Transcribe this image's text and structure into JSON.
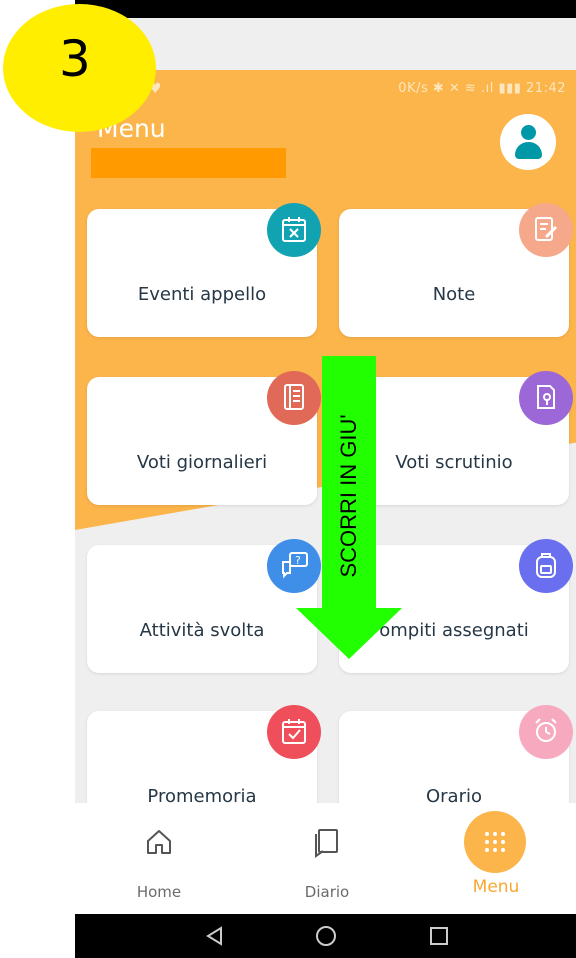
{
  "step_number": "3",
  "statusbar": {
    "left_glyph": "♥",
    "right_text": "0K/s ✱ ✕ ≋ .ıl ▮▮▮ 21:42"
  },
  "header": {
    "title": "Menu"
  },
  "cards": [
    {
      "label": "Eventi appello",
      "badge_color": "#12a3b3",
      "icon": "calendar-x-icon"
    },
    {
      "label": "Note",
      "badge_color": "#f5a88a",
      "icon": "note-edit-icon"
    },
    {
      "label": "Voti giornalieri",
      "badge_color": "#e06a57",
      "icon": "notebook-icon"
    },
    {
      "label": "Voti scrutinio",
      "badge_color": "#9c67d6",
      "icon": "report-icon"
    },
    {
      "label": "Attività svolta",
      "badge_color": "#3f8ee8",
      "icon": "chat-question-icon"
    },
    {
      "label": "ompiti assegnati",
      "badge_color": "#6a6ff0",
      "icon": "backpack-icon"
    },
    {
      "label": "Promemoria",
      "badge_color": "#ef4f5b",
      "icon": "calendar-check-icon"
    },
    {
      "label": "Orario",
      "badge_color": "#f6a9bf",
      "icon": "alarm-clock-icon"
    }
  ],
  "overlay": {
    "arrow_text": "SCORRI IN GIU'",
    "arrow_color": "#22ff00"
  },
  "bottom_nav": {
    "home": "Home",
    "diario": "Diario",
    "menu": "Menu",
    "active_color": "#fbb54a"
  }
}
